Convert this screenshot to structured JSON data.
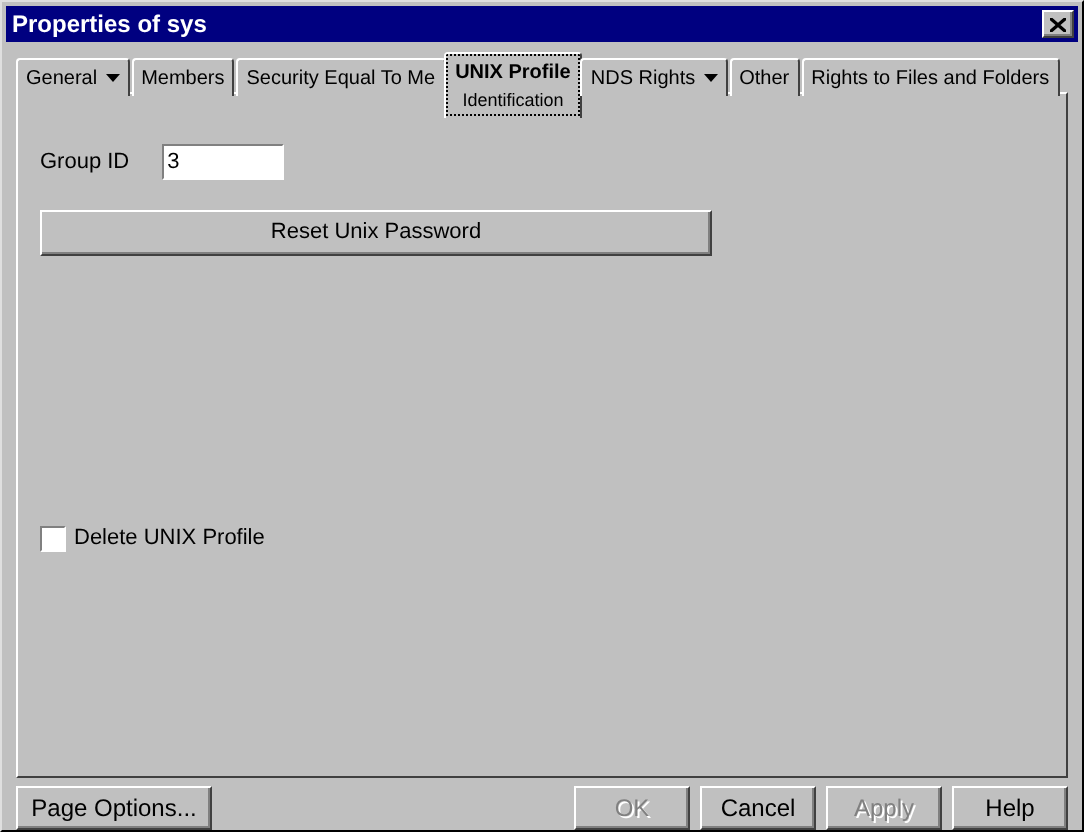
{
  "window": {
    "title": "Properties of sys"
  },
  "tabs": [
    {
      "label": "General",
      "selected": false,
      "dropdown": true
    },
    {
      "label": "Members",
      "selected": false,
      "dropdown": false
    },
    {
      "label": "Security Equal To Me",
      "selected": false,
      "dropdown": false
    },
    {
      "label": "UNIX Profile",
      "sublabel": "Identification",
      "selected": true,
      "dropdown": false
    },
    {
      "label": "NDS Rights",
      "selected": false,
      "dropdown": true
    },
    {
      "label": "Other",
      "selected": false,
      "dropdown": false
    },
    {
      "label": "Rights to Files and Folders",
      "selected": false,
      "dropdown": false
    }
  ],
  "group_id": {
    "label": "Group ID",
    "value": "3"
  },
  "reset_button": {
    "label": "Reset Unix Password"
  },
  "delete_profile": {
    "label": "Delete UNIX Profile",
    "checked": false
  },
  "buttons": [
    {
      "label": "Page Options...",
      "disabled": false
    },
    {
      "label": "OK",
      "disabled": true
    },
    {
      "label": "Cancel",
      "disabled": false
    },
    {
      "label": "Apply",
      "disabled": true
    },
    {
      "label": "Help",
      "disabled": false
    }
  ]
}
